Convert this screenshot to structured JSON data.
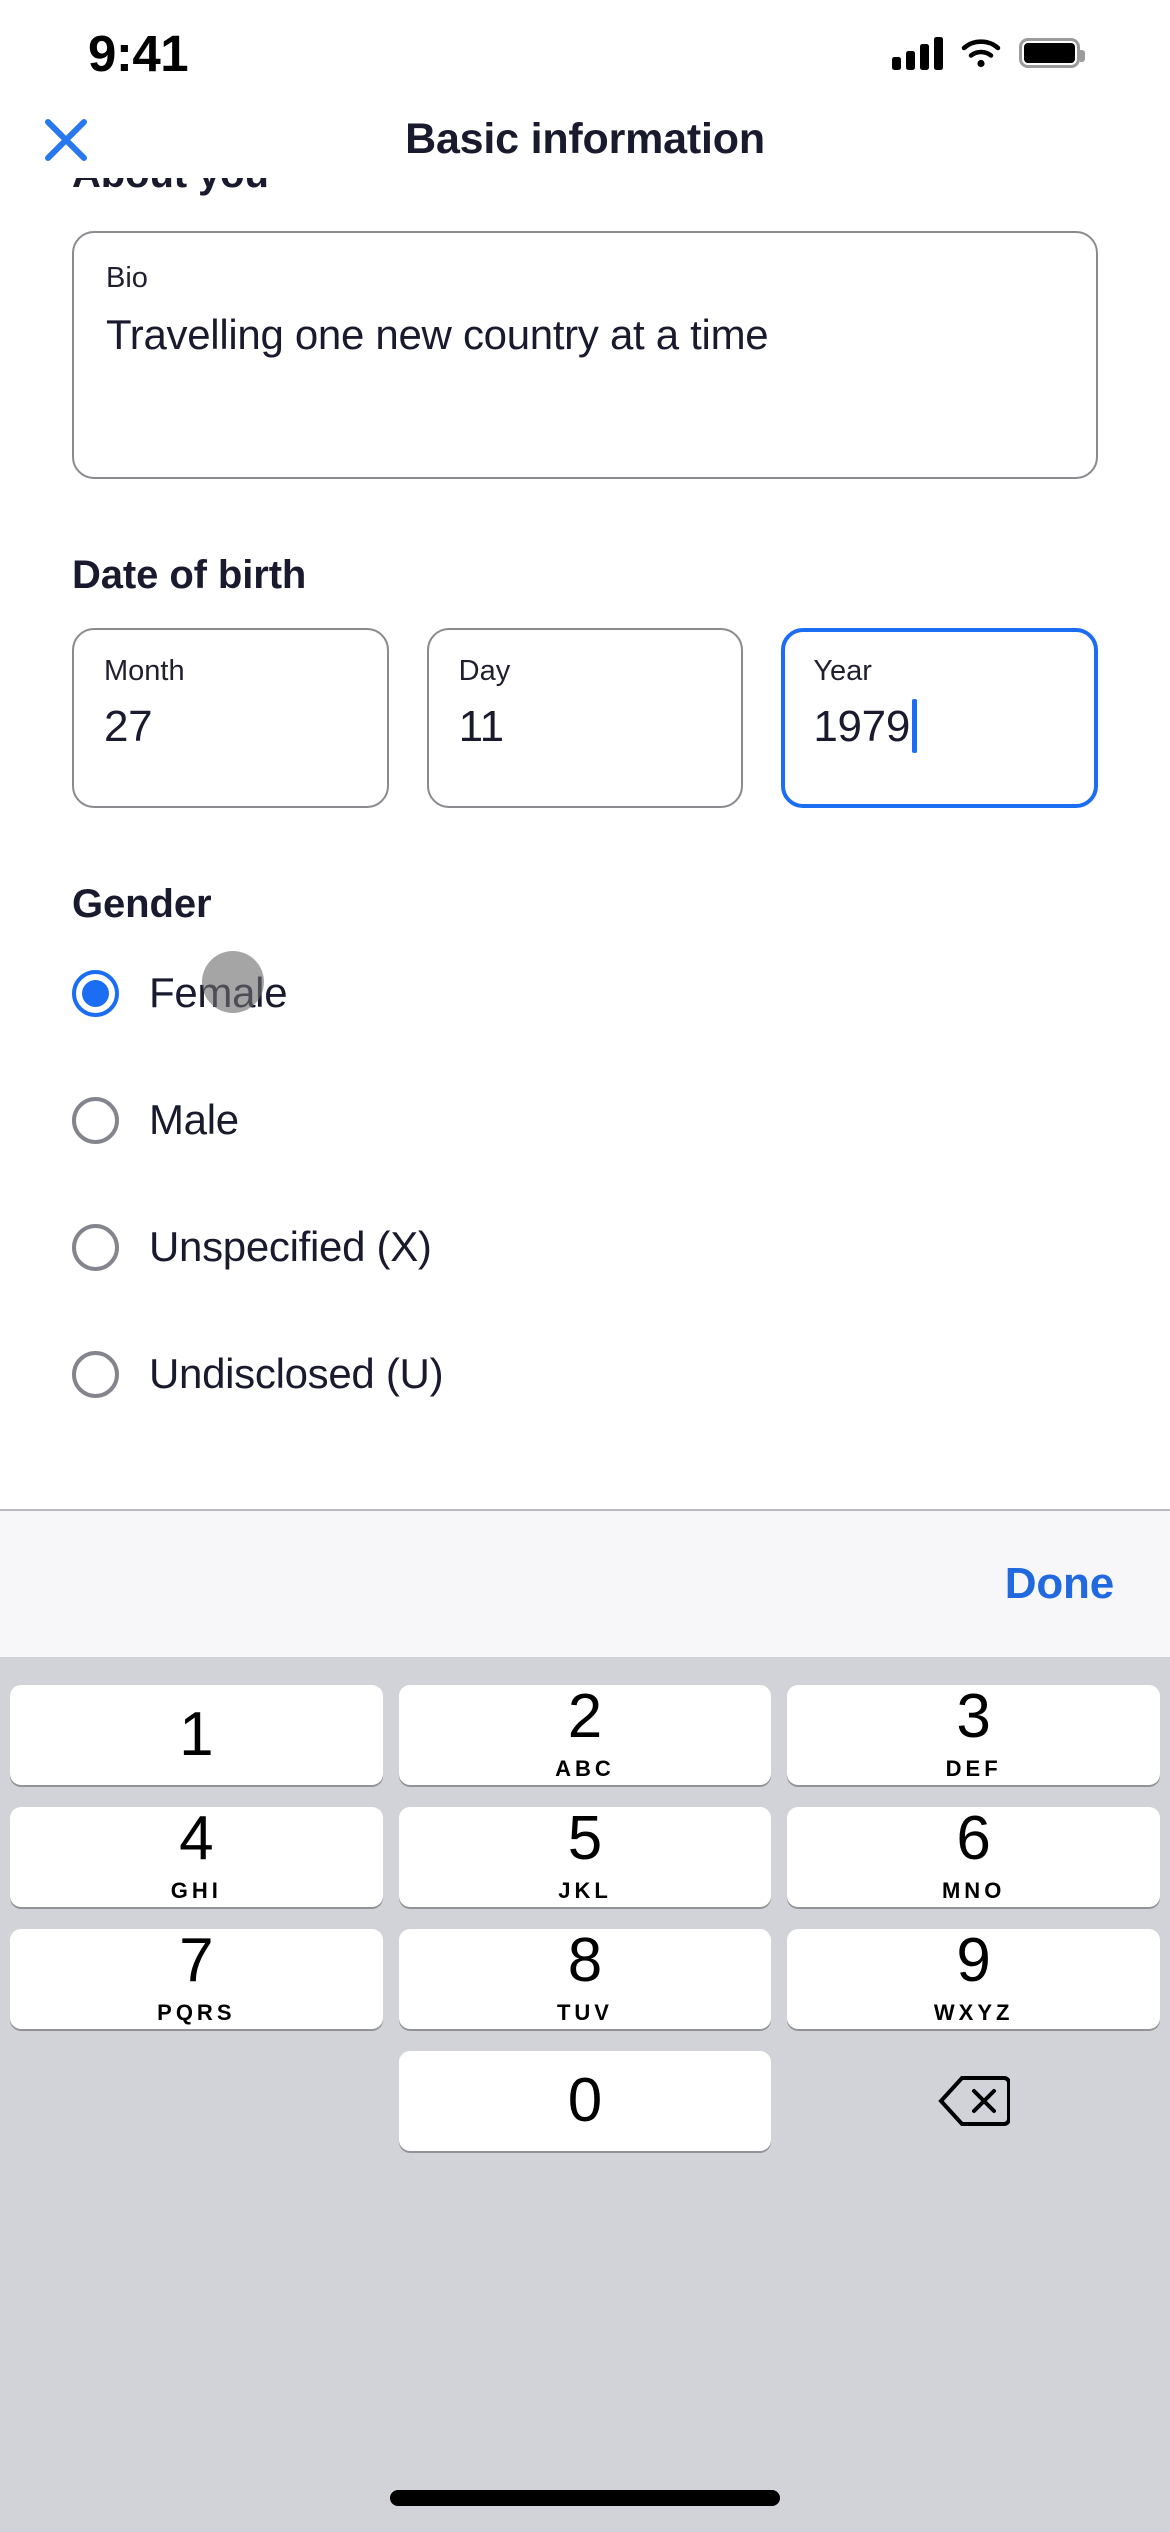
{
  "status_bar": {
    "time": "9:41",
    "cellular_icon": "signal-bars-icon",
    "wifi_icon": "wifi-icon",
    "battery_icon": "battery-full-icon"
  },
  "header": {
    "close_icon": "close-x-icon",
    "title": "Basic information"
  },
  "about_you": {
    "section_label": "About you",
    "bio": {
      "label": "Bio",
      "value": "Travelling one new country at a time"
    }
  },
  "date_of_birth": {
    "section_label": "Date of birth",
    "fields": [
      {
        "label": "Month",
        "value": "27",
        "focused": false
      },
      {
        "label": "Day",
        "value": "11",
        "focused": false
      },
      {
        "label": "Year",
        "value": "1979",
        "focused": true
      }
    ]
  },
  "gender": {
    "section_label": "Gender",
    "options": [
      {
        "label": "Female",
        "selected": true
      },
      {
        "label": "Male",
        "selected": false
      },
      {
        "label": "Unspecified (X)",
        "selected": false
      },
      {
        "label": "Undisclosed (U)",
        "selected": false
      }
    ]
  },
  "keyboard": {
    "done_label": "Done",
    "keys": [
      {
        "num": "1",
        "letters": ""
      },
      {
        "num": "2",
        "letters": "ABC"
      },
      {
        "num": "3",
        "letters": "DEF"
      },
      {
        "num": "4",
        "letters": "GHI"
      },
      {
        "num": "5",
        "letters": "JKL"
      },
      {
        "num": "6",
        "letters": "MNO"
      },
      {
        "num": "7",
        "letters": "PQRS"
      },
      {
        "num": "8",
        "letters": "TUV"
      },
      {
        "num": "9",
        "letters": "WXYZ"
      },
      {
        "num": "0",
        "letters": ""
      }
    ],
    "delete_icon": "backspace-delete-icon"
  },
  "colors": {
    "accent_blue": "#1b6ef3",
    "done_blue": "#2069df",
    "text_dark": "#1a1a2e",
    "border_gray": "#8a8a8f",
    "keyboard_bg": "#d1d3d9"
  }
}
